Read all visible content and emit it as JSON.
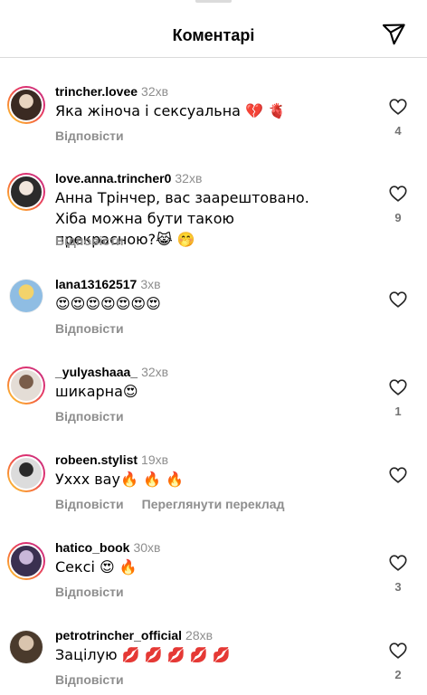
{
  "header": {
    "title": "Коментарі",
    "send_icon": "paper-plane-icon"
  },
  "comments": [
    {
      "username": "trincher.lovee",
      "time": "32хв",
      "text": "Яка жіноча і сексуальна 💔 🫀",
      "reply": "Відповісти",
      "likes": "4",
      "avatar_colors": [
        "#3a2a22",
        "#e8d4c0"
      ]
    },
    {
      "username": "love.anna.trincher0",
      "time": "32хв",
      "text": "Анна Трінчер, вас заарештовано. Хіба можна бути такою прекрасною?😹 🤭",
      "reply": "Відповісти",
      "likes": "9",
      "avatar_colors": [
        "#2b2b2b",
        "#f1e6dc"
      ]
    },
    {
      "username": "lana13162517",
      "time": "3хв",
      "text": "😍😍😍😍😍😍😍",
      "reply": "Відповісти",
      "likes": "",
      "avatar_colors": [
        "#8fbde3",
        "#f3d36b"
      ]
    },
    {
      "username": "_yulyashaaa_",
      "time": "32хв",
      "text": "шикарна😍",
      "reply": "Відповісти",
      "likes": "1",
      "avatar_colors": [
        "#e4ddd6",
        "#7a5d4a"
      ]
    },
    {
      "username": "robeen.stylist",
      "time": "19хв",
      "text": "Уххх вау🔥 🔥 🔥",
      "reply": "Відповісти",
      "translate": "Переглянути переклад",
      "likes": "",
      "avatar_colors": [
        "#dcdcdc",
        "#2a2a2a"
      ]
    },
    {
      "username": "hatico_book",
      "time": "30хв",
      "text": "Сексі 😍 🔥",
      "reply": "Відповісти",
      "likes": "3",
      "avatar_colors": [
        "#3a3050",
        "#c9b7d9"
      ]
    },
    {
      "username": "petrotrincher_official",
      "time": "28хв",
      "text": "Зацілую 💋 💋 💋 💋 💋",
      "reply": "Відповісти",
      "likes": "2",
      "avatar_colors": [
        "#4a3a2c",
        "#d9c4ae"
      ]
    }
  ]
}
